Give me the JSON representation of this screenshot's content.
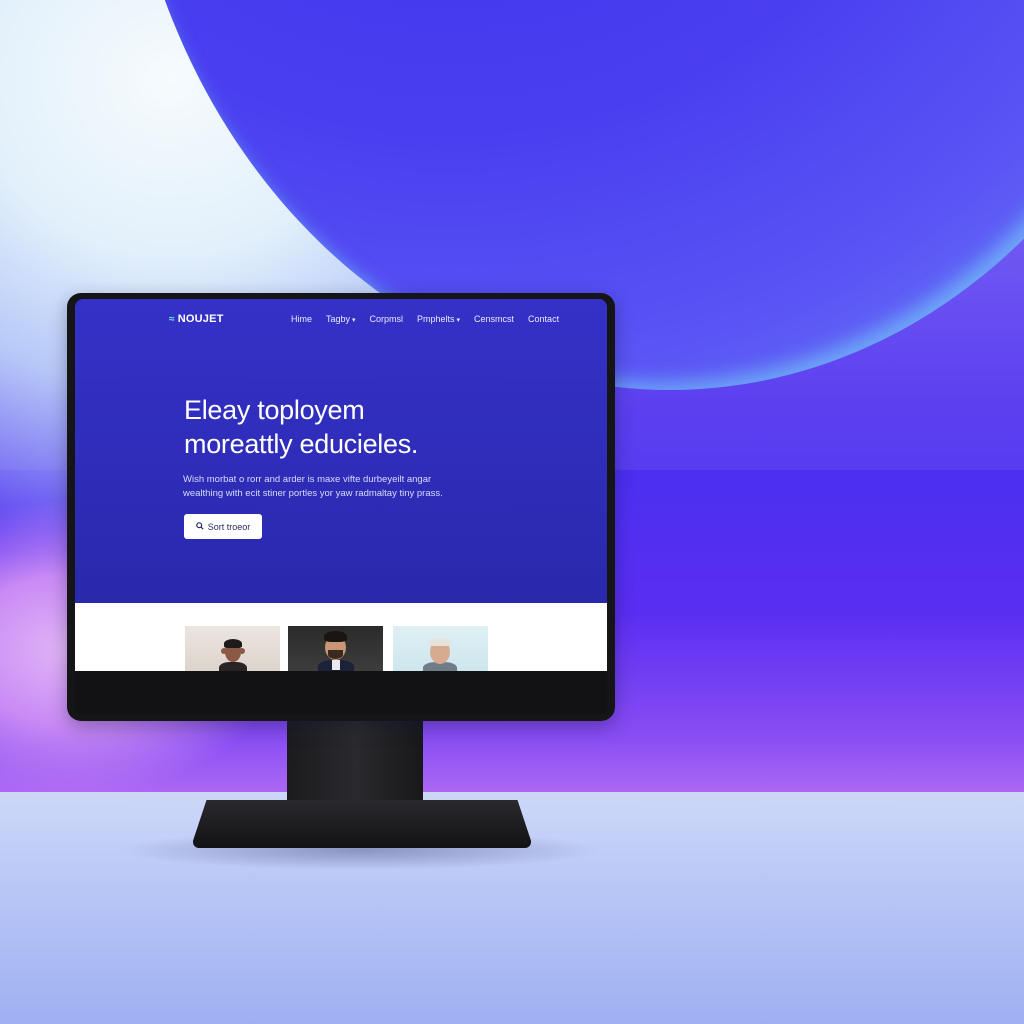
{
  "website": {
    "logo": {
      "icon": "wave-logo-icon",
      "text": "NOUJET"
    },
    "nav": [
      {
        "label": "Hime",
        "has_dropdown": false
      },
      {
        "label": "Tagby",
        "has_dropdown": true
      },
      {
        "label": "Corpmsl",
        "has_dropdown": false
      },
      {
        "label": "Pmphelts",
        "has_dropdown": true
      },
      {
        "label": "Censmcst",
        "has_dropdown": false
      },
      {
        "label": "Contact",
        "has_dropdown": false
      }
    ],
    "hero": {
      "title_line1": "Eleay toployem",
      "title_line2": "moreattly educieles.",
      "subtitle_line1": "Wish morbat o rorr and arder is maxe vifte durbeyeilt angar",
      "subtitle_line2": "wealthing with ecit stiner portles yor yaw radmaltay tiny prass."
    },
    "cta": {
      "icon": "search-icon",
      "label": "Sort troeor"
    },
    "photos": [
      "person-photo-woman",
      "person-photo-man-beard",
      "person-photo-older-man"
    ]
  },
  "colors": {
    "hero_bg": "#2f2ebd",
    "accent_logo": "#6ee7e0",
    "monitor": "#151517"
  }
}
